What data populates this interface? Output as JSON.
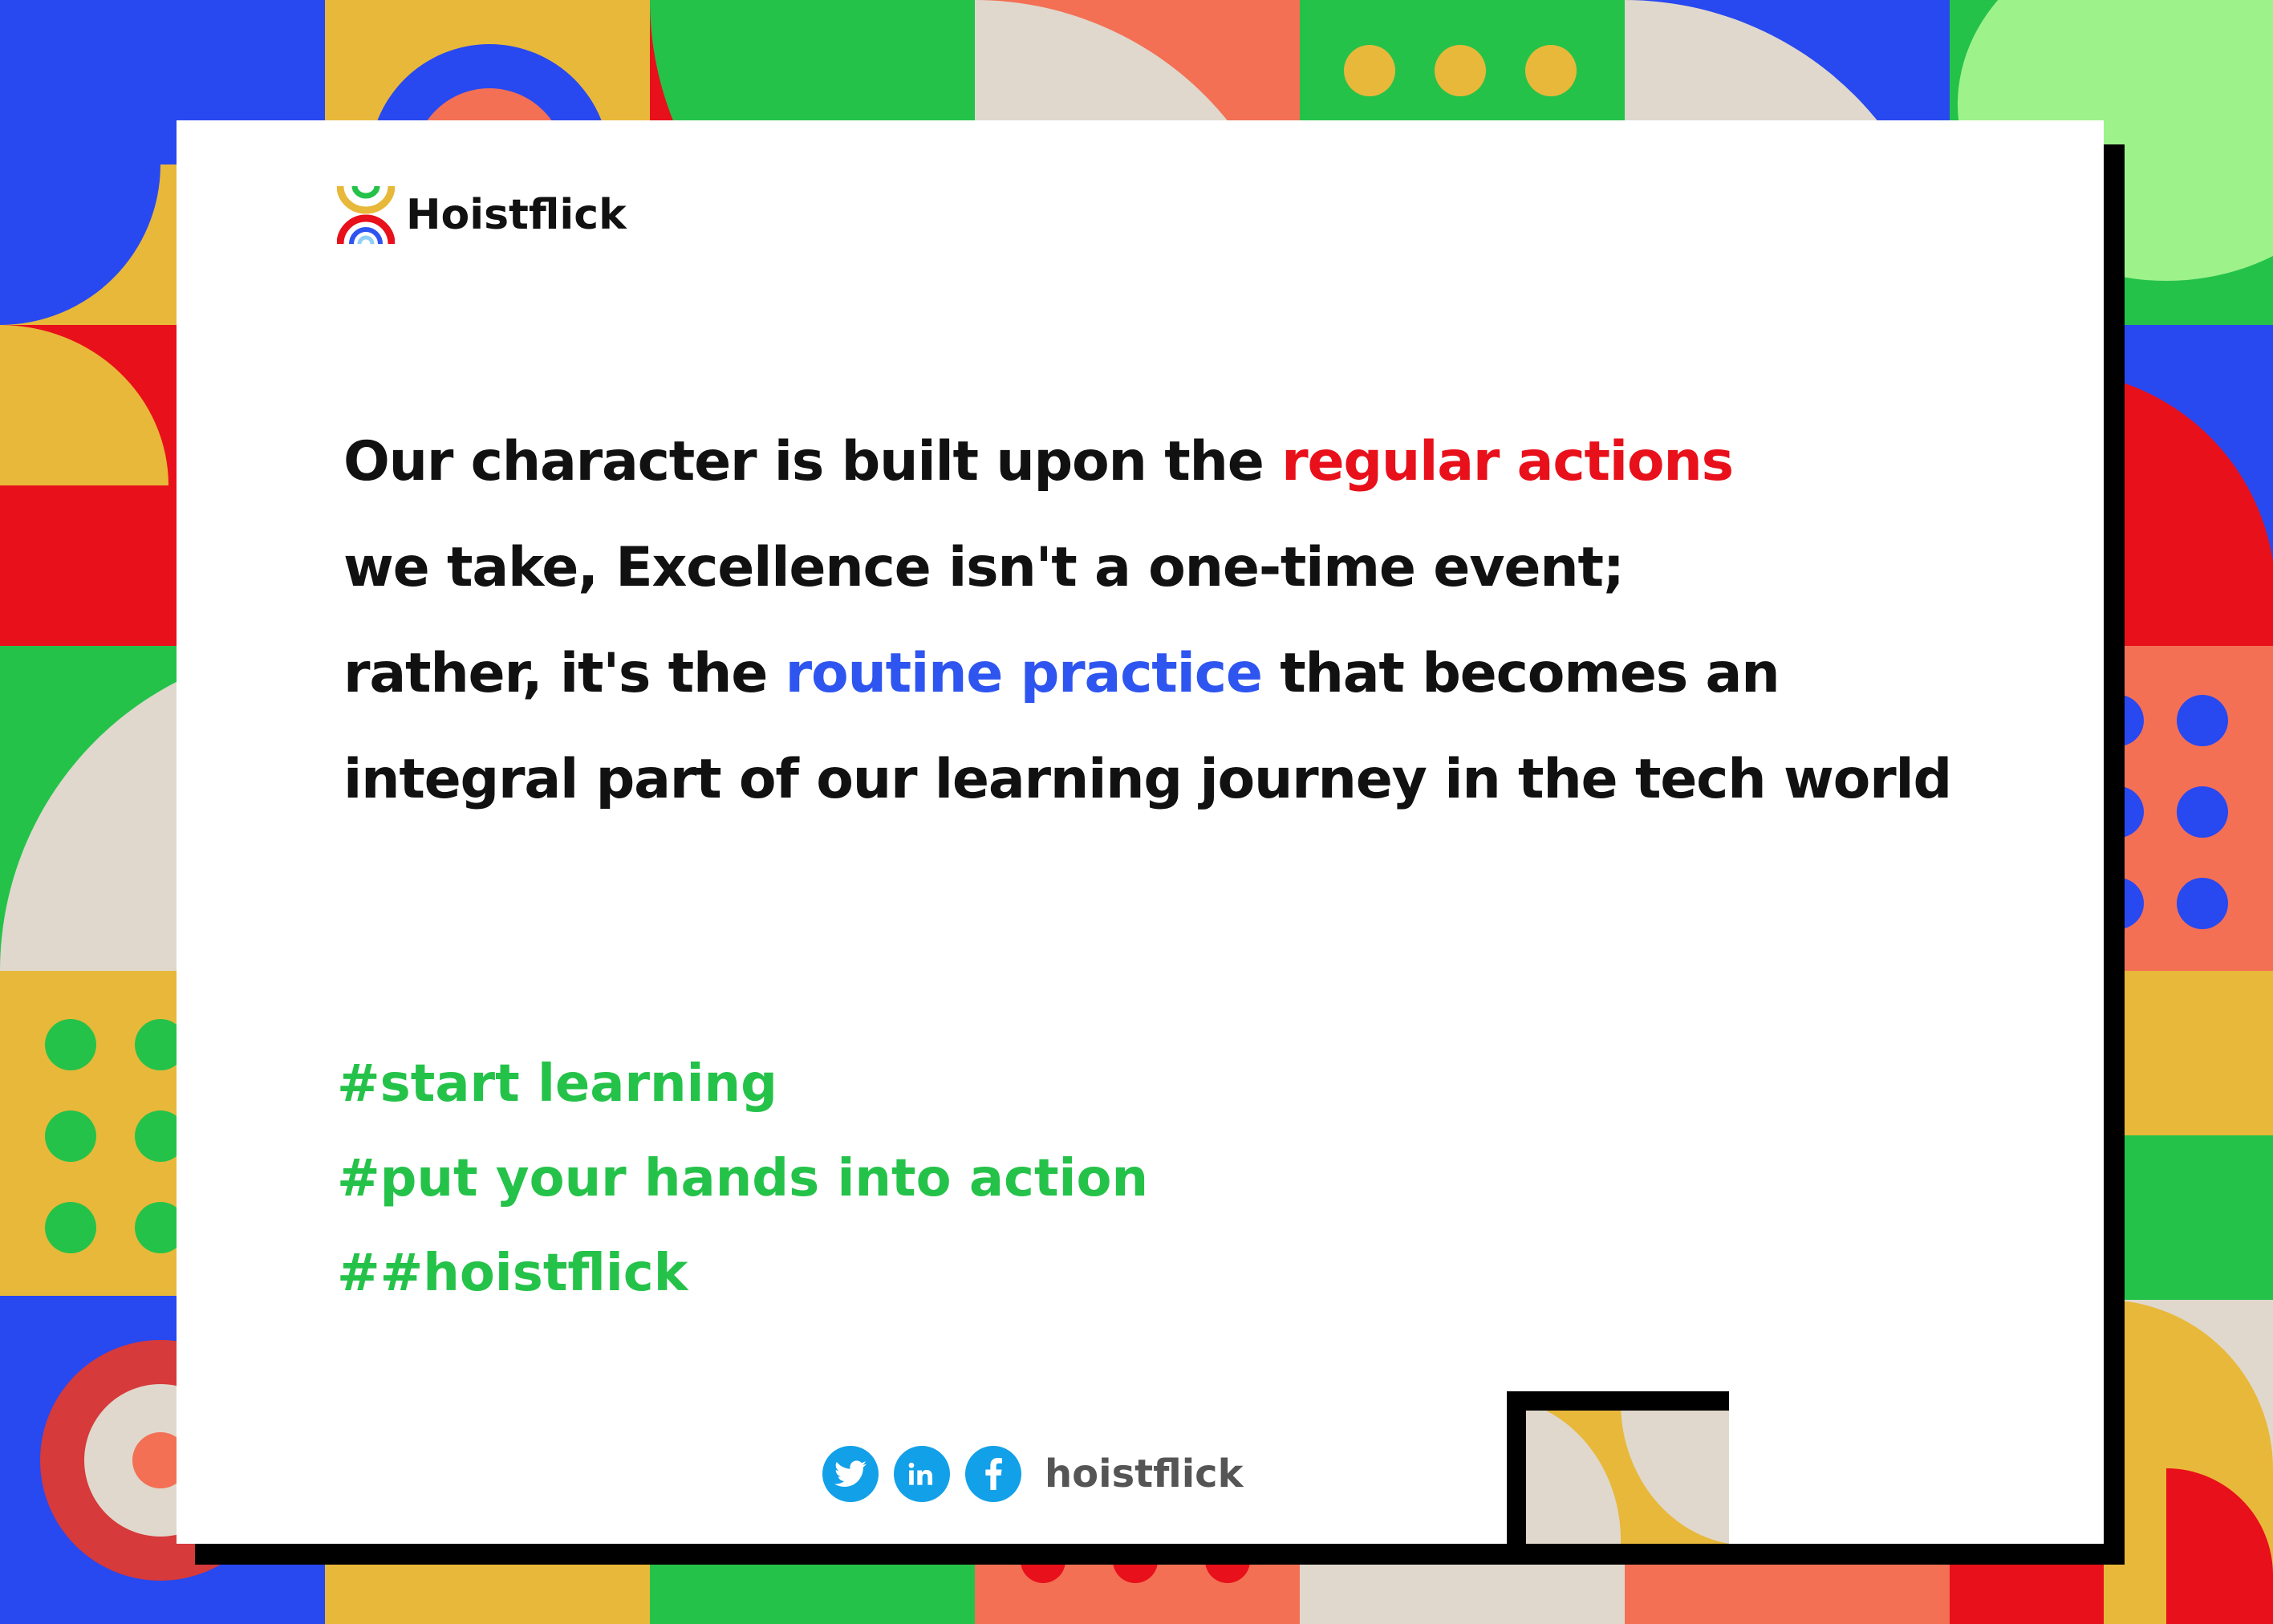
{
  "brand": {
    "name": "Hoistflick"
  },
  "quote": {
    "line1_a": "Our character is built upon the ",
    "line1_highlight": "regular actions",
    "line2": "we take, Excellence isn't a one-time event;",
    "line3_a": "rather, it's the ",
    "line3_highlight": "routine practice",
    "line3_b": " that becomes an",
    "line4": "integral part of our learning journey in the tech world"
  },
  "hashtags": [
    "#start learning",
    "#put your hands into action",
    "##hoistflick"
  ],
  "footer": {
    "icons": [
      "twitter-icon",
      "linkedin-icon",
      "facebook-icon"
    ],
    "handle": "hoistflick"
  },
  "colors": {
    "highlight_red": "#e8101a",
    "highlight_blue": "#2e55f0",
    "hashtag_green": "#25c24a",
    "social_blue": "#12a0e8"
  }
}
